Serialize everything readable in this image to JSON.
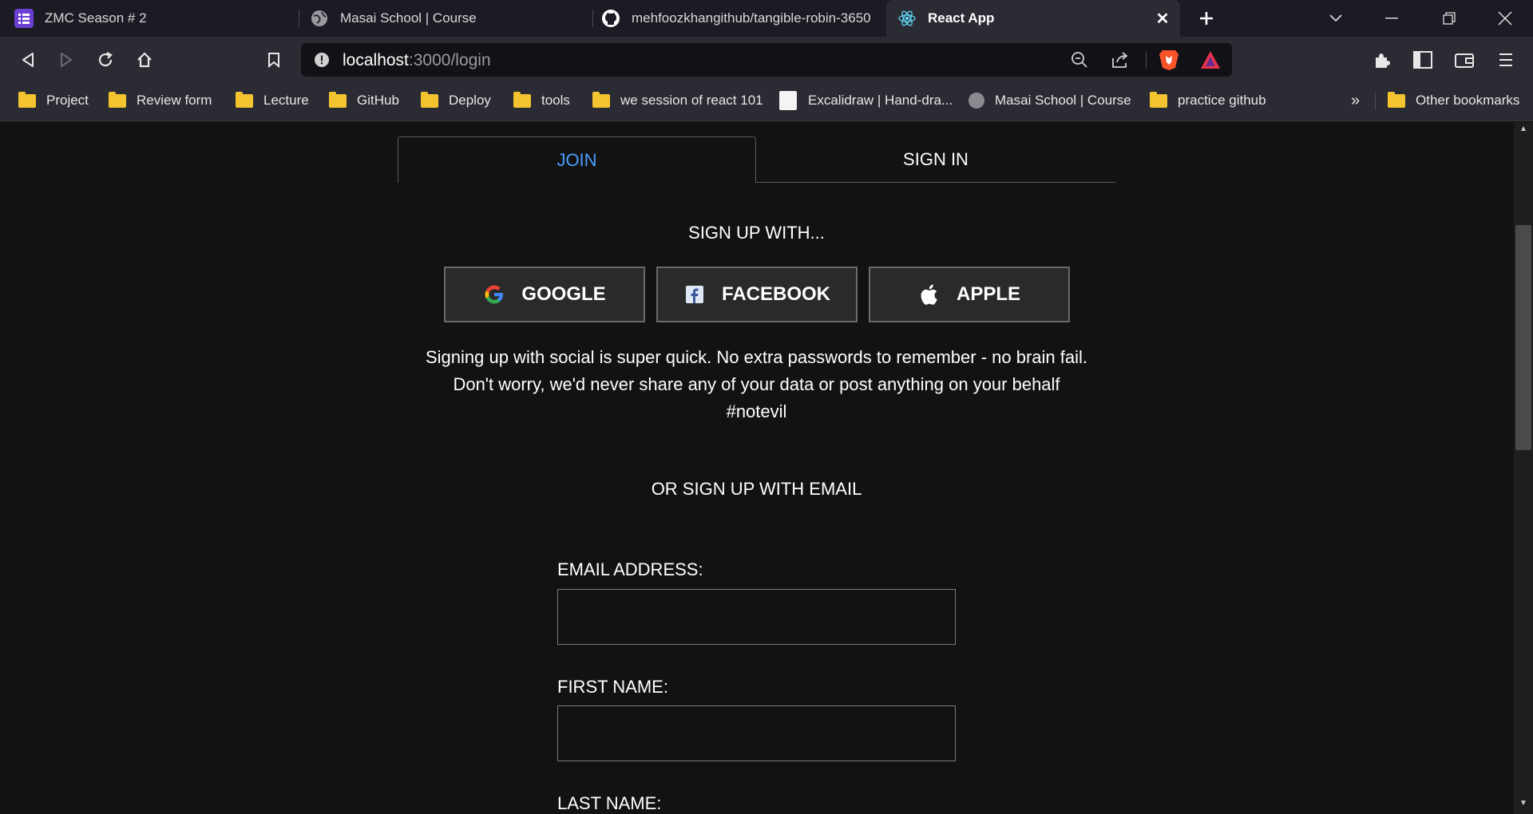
{
  "browser": {
    "tabs": [
      {
        "title": "ZMC Season # 2",
        "icon": "list-icon"
      },
      {
        "title": "Masai School | Course",
        "icon": "globe-icon"
      },
      {
        "title": "mehfoozkhangithub/tangible-robin-3650",
        "icon": "github-icon"
      },
      {
        "title": "React App",
        "icon": "react-icon",
        "active": true
      }
    ],
    "address": {
      "host": "localhost",
      "path": ":3000/login"
    },
    "bookmarks": [
      {
        "label": "Project",
        "icon": "folder-icon"
      },
      {
        "label": "Review form",
        "icon": "folder-icon"
      },
      {
        "label": "Lecture",
        "icon": "folder-icon"
      },
      {
        "label": "GitHub",
        "icon": "folder-icon"
      },
      {
        "label": "Deploy",
        "icon": "folder-icon"
      },
      {
        "label": "tools",
        "icon": "folder-icon"
      },
      {
        "label": "we session of react 101",
        "icon": "folder-icon"
      },
      {
        "label": "Excalidraw | Hand-dra...",
        "icon": "excalidraw-icon"
      },
      {
        "label": "Masai School | Course",
        "icon": "globe-icon"
      },
      {
        "label": "practice github",
        "icon": "folder-icon"
      }
    ],
    "overflow": "»",
    "other_bookmarks": "Other bookmarks"
  },
  "auth": {
    "tab_join": "JOIN",
    "tab_signin": "SIGN IN",
    "signup_with": "SIGN UP WITH...",
    "social": {
      "google": "GOOGLE",
      "facebook": "FACEBOOK",
      "apple": "APPLE"
    },
    "blurb_line1": "Signing up with social is super quick. No extra passwords to remember - no brain fail.",
    "blurb_line2": "Don't worry, we'd never share any of your data or post anything on your behalf",
    "blurb_line3": "#notevil",
    "or_email": "OR SIGN UP WITH EMAIL",
    "email_label": "EMAIL ADDRESS:",
    "first_name_label": "FIRST NAME:",
    "last_name_label": "LAST NAME:",
    "email_value": "",
    "first_name_value": ""
  },
  "colors": {
    "accent": "#4a9eff",
    "background": "#121212",
    "chrome": "#2b2b33"
  }
}
